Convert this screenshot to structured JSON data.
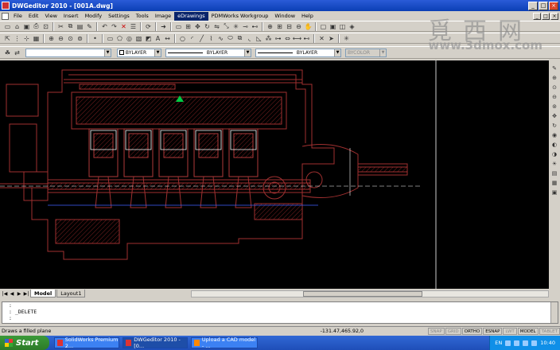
{
  "window": {
    "title": "DWGeditor 2010 - [001A.dwg]"
  },
  "menu": [
    "File",
    "Edit",
    "View",
    "Insert",
    "Modify",
    "Settings",
    "Tools",
    "Image",
    "eDrawings",
    "PDMWorks Workgroup",
    "Window",
    "Help"
  ],
  "menu_active_index": 8,
  "properties_toolbar": {
    "color": "BYLAYER",
    "linetype": "BYLAYER",
    "lineweight": "BYLAYER",
    "plotstyle": "BYCOLOR"
  },
  "watermark": {
    "chinese": "覓西网",
    "url": "www.3dmox.com"
  },
  "layout_tabs": [
    "Model",
    "Layout1"
  ],
  "command_lines": [
    ": ",
    ": _DELETE",
    ": "
  ],
  "status": {
    "message": "Draws a filled plane",
    "coords": "-131.47,465.92,0",
    "toggles": [
      {
        "label": "SNAP",
        "on": false
      },
      {
        "label": "GRID",
        "on": false
      },
      {
        "label": "ORTHO",
        "on": true
      },
      {
        "label": "ESNAP",
        "on": true
      },
      {
        "label": "LWT",
        "on": false
      },
      {
        "label": "MODEL",
        "on": true
      },
      {
        "label": "TABLET",
        "on": false
      }
    ]
  },
  "taskbar": {
    "start_label": "Start",
    "tasks": [
      "SolidWorks Premium 2...",
      "DWGeditor 2010 - [0...",
      "Upload a CAD model - ..."
    ],
    "active_task": 1,
    "tray_lang": "EN",
    "clock": "10:40"
  },
  "colors": {
    "titlebar": "#0b3fb5",
    "drawing_bg": "#000000",
    "cad_line": "#a03030",
    "cad_fill": "#5a1515",
    "highlight": "#00cc44"
  }
}
